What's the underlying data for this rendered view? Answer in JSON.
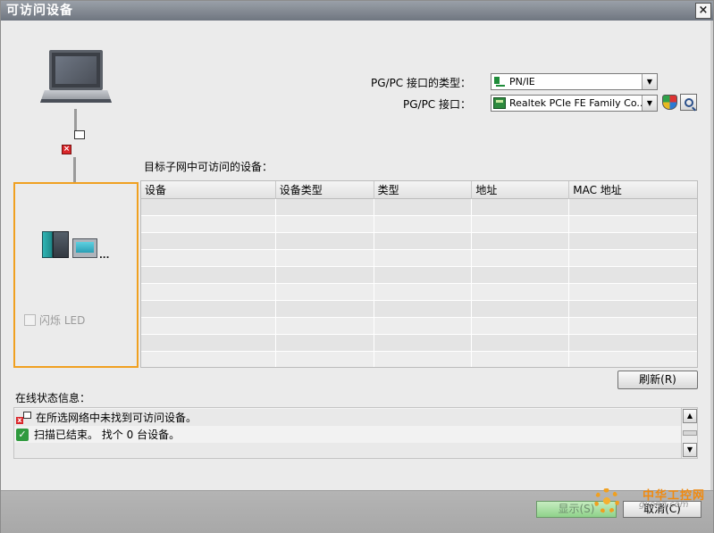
{
  "window": {
    "title": "可访问设备",
    "close_label": "×"
  },
  "interface": {
    "type_label": "PG/PC 接口的类型：",
    "type_value": "PN/IE",
    "port_label": "PG/PC 接口：",
    "port_value": "Realtek PCIe FE Family Co..."
  },
  "diagram": {
    "flash_led_label": "闪烁 LED",
    "more_devices": "..."
  },
  "devices": {
    "title": "目标子网中可访问的设备：",
    "columns": [
      "设备",
      "设备类型",
      "类型",
      "地址",
      "MAC 地址"
    ],
    "rows": [
      [],
      [],
      [],
      [],
      [],
      [],
      [],
      [],
      [],
      []
    ],
    "refresh_label": "刷新(R)"
  },
  "status": {
    "title": "在线状态信息：",
    "messages": [
      {
        "icon": "network-error-icon",
        "text": "在所选网络中未找到可访问设备。"
      },
      {
        "icon": "check-icon",
        "text": "扫描已结束。 找个 0 台设备。"
      }
    ]
  },
  "footer": {
    "show_label": "显示(S)",
    "cancel_label": "取消(C)"
  },
  "watermark": {
    "line1": "中华工控网",
    "line2": "gkong.com"
  },
  "colors": {
    "highlight_border": "#f0a020",
    "ok_green": "#2f9a3e",
    "error_red": "#d9262a"
  }
}
